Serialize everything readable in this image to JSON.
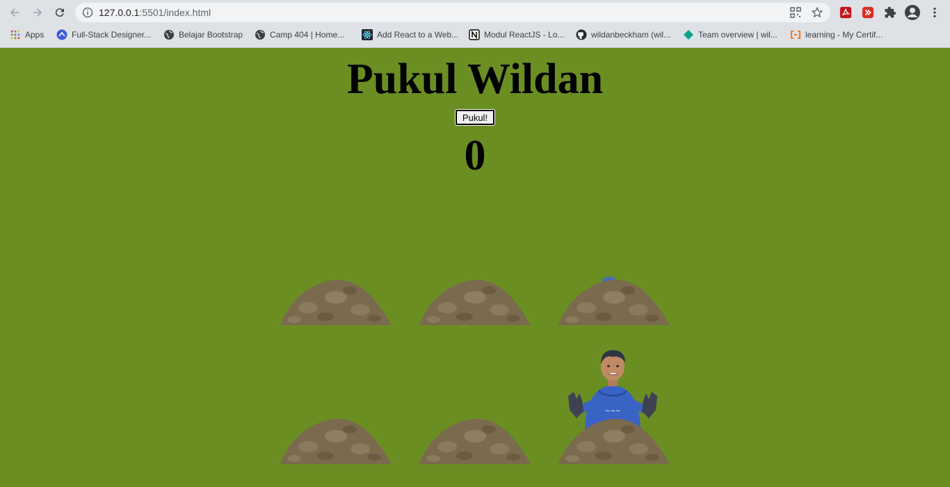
{
  "browser": {
    "url_host": "127.0.0.1",
    "url_rest": ":5501/index.html",
    "bookmarks": [
      {
        "label": "Apps",
        "icon": "apps-grid-icon"
      },
      {
        "label": "Full-Stack Designer...",
        "icon": "blue-circle-icon"
      },
      {
        "label": "Belajar Bootstrap",
        "icon": "globe-icon"
      },
      {
        "label": "Camp 404 | Home...",
        "icon": "globe-icon"
      },
      {
        "label": "Add React to a Web...",
        "icon": "react-icon"
      },
      {
        "label": "Modul ReactJS - Lo...",
        "icon": "notion-icon"
      },
      {
        "label": "wildanbeckham (wil...",
        "icon": "github-icon"
      },
      {
        "label": "Team overview | wil...",
        "icon": "diamond-icon"
      },
      {
        "label": "learning - My Certif...",
        "icon": "bracket-icon"
      }
    ]
  },
  "game": {
    "title": "Pukul Wildan",
    "button_label": "Pukul!",
    "score": "0"
  },
  "colors": {
    "background": "#6b8e23",
    "dirt": "#7a6a4e"
  }
}
